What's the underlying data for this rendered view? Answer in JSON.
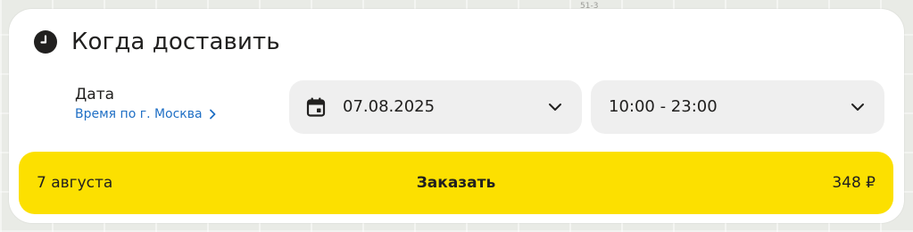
{
  "map": {
    "label": "51-3"
  },
  "delivery": {
    "title": "Когда доставить",
    "title_icon": "clock-icon",
    "date_label": "Дата",
    "timezone_link": "Время по г. Москва",
    "date_select": {
      "value": "07.08.2025",
      "icon": "calendar-icon"
    },
    "time_select": {
      "value": "10:00 - 23:00"
    }
  },
  "order_button": {
    "date_text": "7 августа",
    "label": "Заказать",
    "price": "348 ₽",
    "color": "#fce000"
  },
  "colors": {
    "link": "#1f6fc5",
    "select_bg": "#efefef"
  }
}
